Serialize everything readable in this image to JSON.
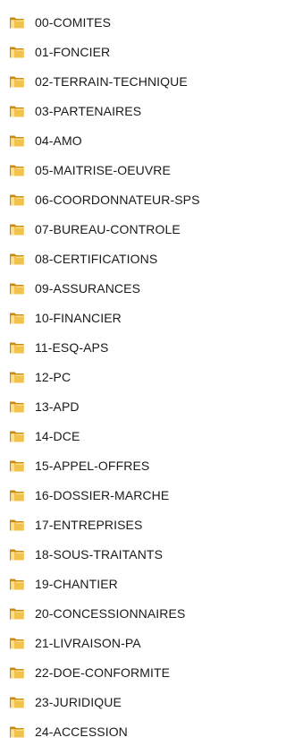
{
  "icon_name": "folder-icon",
  "colors": {
    "folder_back": "#c98a12",
    "folder_front": "#f3c24c",
    "folder_highlight": "#fbe08f",
    "text": "#1a1a1a"
  },
  "folders": [
    {
      "name": "00-COMITES"
    },
    {
      "name": "01-FONCIER"
    },
    {
      "name": "02-TERRAIN-TECHNIQUE"
    },
    {
      "name": "03-PARTENAIRES"
    },
    {
      "name": "04-AMO"
    },
    {
      "name": "05-MAITRISE-OEUVRE"
    },
    {
      "name": "06-COORDONNATEUR-SPS"
    },
    {
      "name": "07-BUREAU-CONTROLE"
    },
    {
      "name": "08-CERTIFICATIONS"
    },
    {
      "name": "09-ASSURANCES"
    },
    {
      "name": "10-FINANCIER"
    },
    {
      "name": "11-ESQ-APS"
    },
    {
      "name": "12-PC"
    },
    {
      "name": "13-APD"
    },
    {
      "name": "14-DCE"
    },
    {
      "name": "15-APPEL-OFFRES"
    },
    {
      "name": "16-DOSSIER-MARCHE"
    },
    {
      "name": "17-ENTREPRISES"
    },
    {
      "name": "18-SOUS-TRAITANTS"
    },
    {
      "name": "19-CHANTIER"
    },
    {
      "name": "20-CONCESSIONNAIRES"
    },
    {
      "name": "21-LIVRAISON-PA"
    },
    {
      "name": "22-DOE-CONFORMITE"
    },
    {
      "name": "23-JURIDIQUE"
    },
    {
      "name": "24-ACCESSION"
    }
  ]
}
